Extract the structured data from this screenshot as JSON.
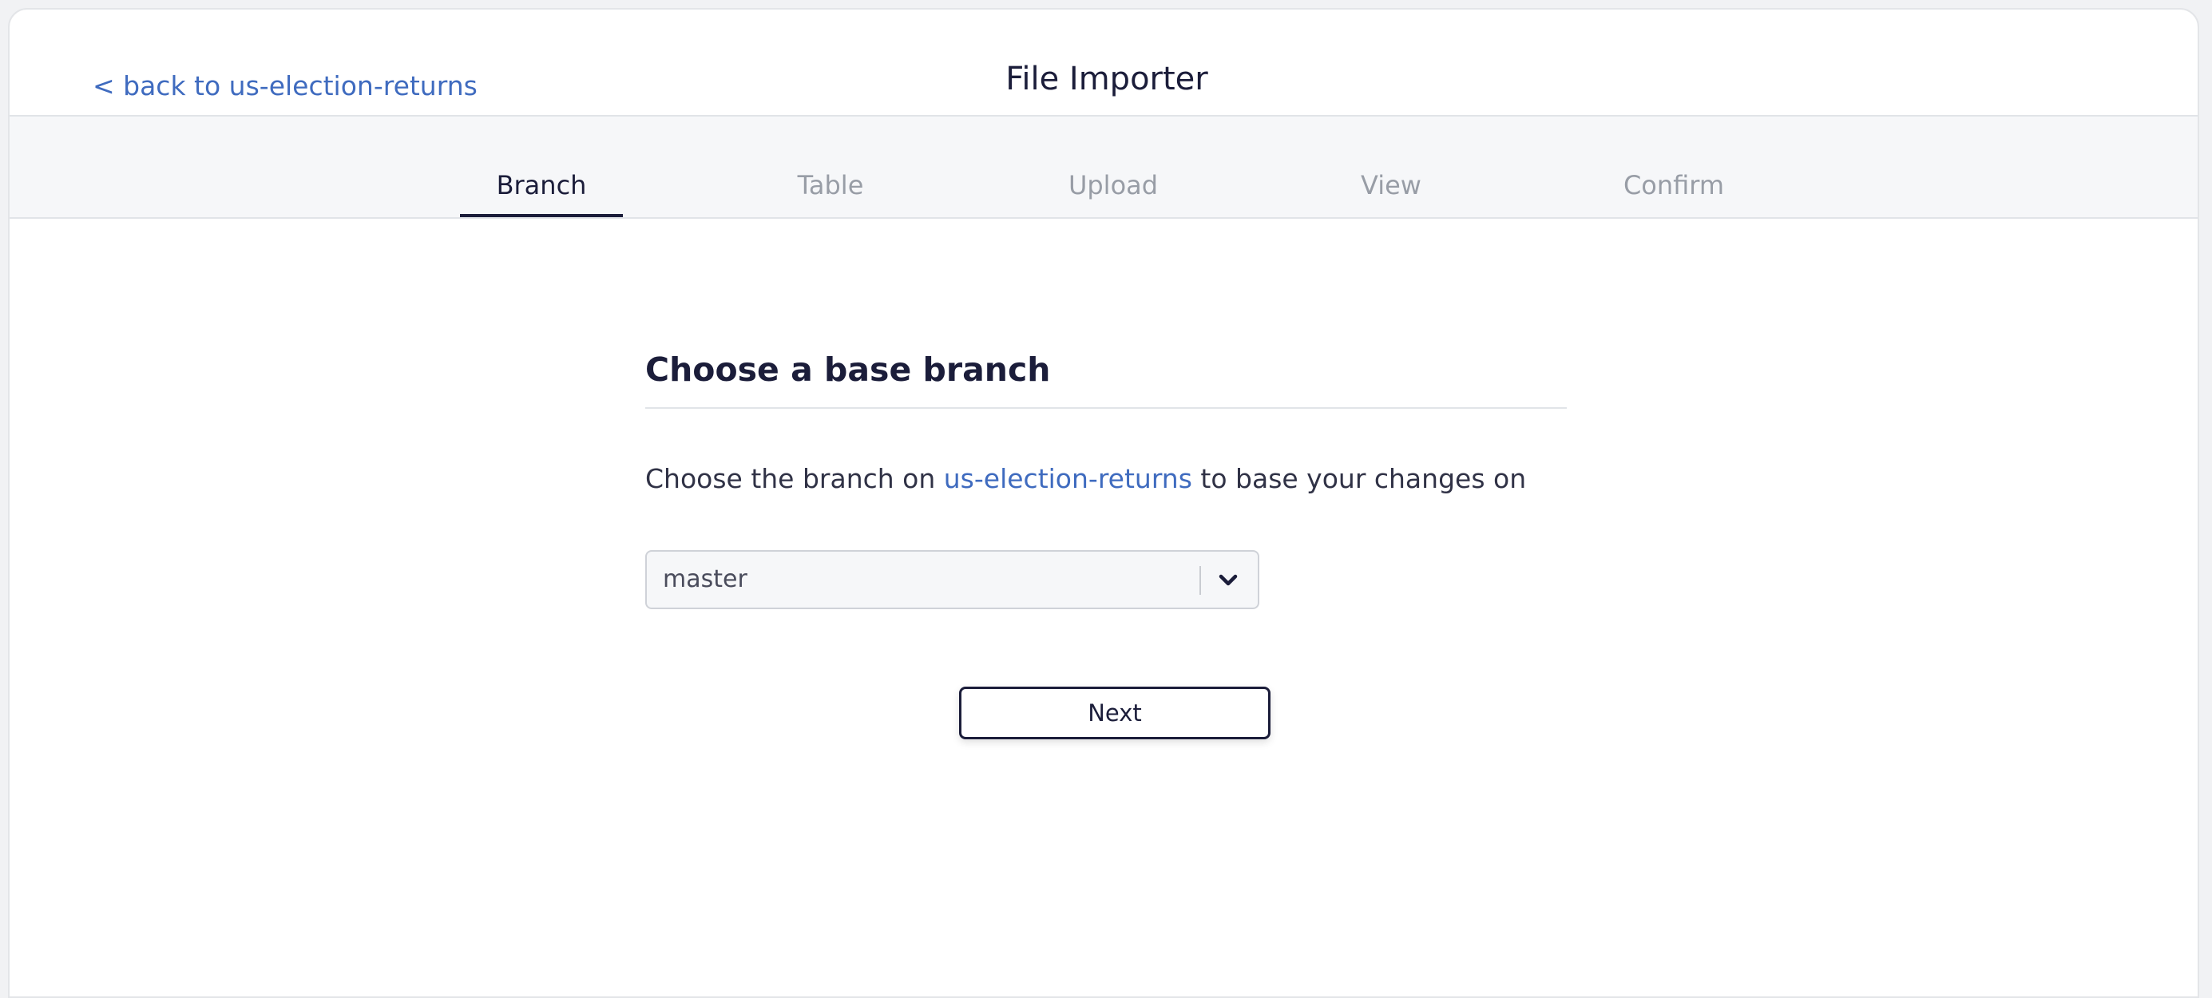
{
  "header": {
    "back_link": "< back to us-election-returns",
    "title": "File Importer"
  },
  "tabs": [
    {
      "label": "Branch",
      "active": true
    },
    {
      "label": "Table",
      "active": false
    },
    {
      "label": "Upload",
      "active": false
    },
    {
      "label": "View",
      "active": false
    },
    {
      "label": "Confirm",
      "active": false
    }
  ],
  "main": {
    "section_title": "Choose a base branch",
    "description_prefix": "Choose the branch on ",
    "repo_name": "us-election-returns",
    "description_suffix": " to base your changes on",
    "branch_select": {
      "value": "master",
      "icon": "chevron-down-icon"
    },
    "next_label": "Next"
  },
  "colors": {
    "accent_link": "#3f6bbf",
    "primary_text": "#1b1d3a",
    "inactive_tab": "#989da6"
  }
}
